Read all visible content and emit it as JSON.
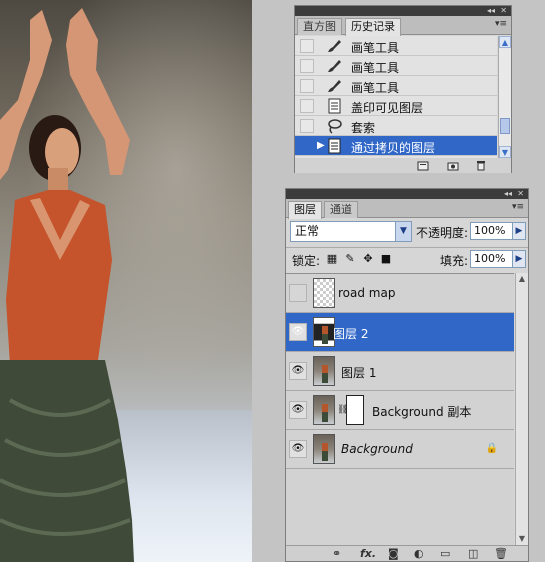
{
  "history_panel": {
    "tabs": [
      {
        "label": "直方图"
      },
      {
        "label": "历史记录"
      }
    ],
    "items": [
      {
        "label": "画笔工具",
        "icon": "brush-icon"
      },
      {
        "label": "画笔工具",
        "icon": "brush-icon"
      },
      {
        "label": "画笔工具",
        "icon": "brush-icon"
      },
      {
        "label": "盖印可见图层",
        "icon": "document-icon"
      },
      {
        "label": "套索",
        "icon": "lasso-icon"
      },
      {
        "label": "通过拷贝的图层",
        "icon": "document-icon",
        "selected": true
      }
    ],
    "bottom_icons": [
      "new-document-from-state-icon",
      "new-snapshot-icon",
      "delete-icon"
    ]
  },
  "layers_panel": {
    "tabs": [
      {
        "label": "图层"
      },
      {
        "label": "通道"
      }
    ],
    "blend_mode": "正常",
    "opacity_label": "不透明度:",
    "opacity_value": "100%",
    "lock_label": "锁定:",
    "fill_label": "填充:",
    "fill_value": "100%",
    "layers": [
      {
        "name": "road map",
        "visible": false,
        "thumb": "transparent"
      },
      {
        "name": "图层 2",
        "visible": true,
        "thumb": "photo",
        "selected": true
      },
      {
        "name": "图层 1",
        "visible": true,
        "thumb": "photo"
      },
      {
        "name": "Background 副本",
        "visible": true,
        "thumb": "photo",
        "mask": true
      },
      {
        "name": "Background",
        "visible": true,
        "thumb": "photo",
        "locked": true
      }
    ],
    "bottom_icons": [
      "link-icon",
      "fx-icon",
      "add-mask-icon",
      "adjustment-layer-icon",
      "new-group-icon",
      "new-layer-icon",
      "delete-icon"
    ],
    "fx_label": "fx."
  },
  "colors": {
    "selection": "#3168c8",
    "panel_bg": "#d6d6d6"
  }
}
